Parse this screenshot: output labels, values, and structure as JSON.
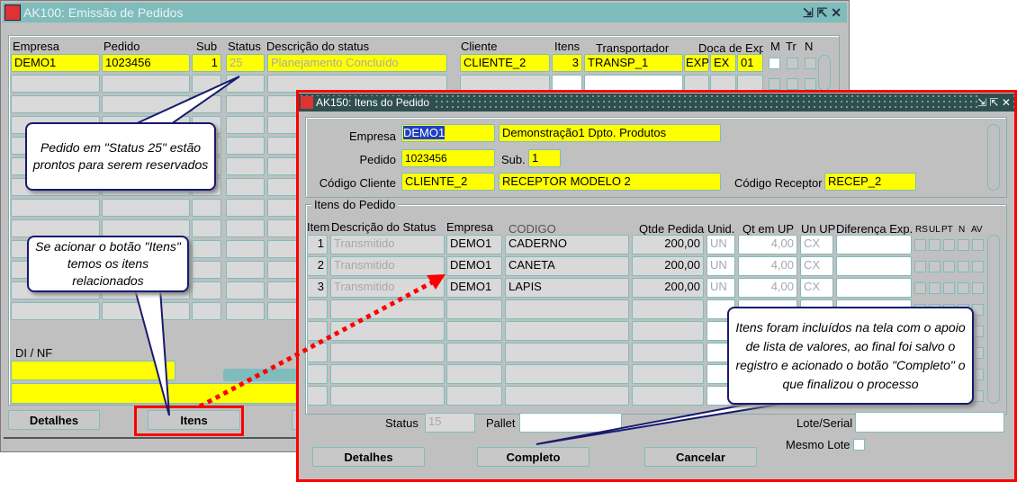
{
  "main_window": {
    "title": "AK100: Emissão de Pedidos",
    "headers": {
      "empresa": "Empresa",
      "pedido": "Pedido",
      "sub": "Sub",
      "status": "Status",
      "descricao": "Descrição do status",
      "cliente": "Cliente",
      "itens": "Itens",
      "transportador": "Transportador",
      "doca": "Doca de Exp",
      "m": "M",
      "tr": "Tr",
      "n": "N"
    },
    "row": {
      "empresa": "DEMO1",
      "pedido": "1023456",
      "sub": "1",
      "status": "25",
      "descricao": "Planejamento Concluído",
      "cliente": "CLIENTE_2",
      "itens": "3",
      "transportador": "TRANSP_1",
      "doca1": "EXP",
      "doca2": "EX",
      "doca3": "01"
    },
    "di_nf_label": "DI / NF",
    "buttons": {
      "detalhes": "Detalhes",
      "itens": "Itens"
    }
  },
  "items_window": {
    "title": "AK150: Itens do Pedido",
    "empresa_label": "Empresa",
    "empresa": "DEMO1",
    "empresa_desc": "Demonstração1 Dpto. Produtos",
    "pedido_label": "Pedido",
    "pedido": "1023456",
    "sub_label": "Sub.",
    "sub": "1",
    "cliente_label": "Código Cliente",
    "cliente": "CLIENTE_2",
    "cliente_desc": "RECEPTOR MODELO 2",
    "receptor_label": "Código Receptor",
    "receptor": "RECEP_2",
    "group_label": "Itens do Pedido",
    "headers": {
      "item": "Item",
      "descricao": "Descrição do Status",
      "empresa": "Empresa",
      "codigo": "CODIGO",
      "qtde": "Qtde Pedida",
      "unid": "Unid.",
      "qtup": "Qt em UP",
      "unup": "Un UP",
      "dif": "Diferença Exp.",
      "rs": "RS",
      "ul": "UL",
      "pt": "PT",
      "n": "N",
      "av": "AV"
    },
    "rows": [
      {
        "item": "1",
        "descricao": "Transmitido",
        "empresa": "DEMO1",
        "codigo": "CADERNO",
        "qtde": "200,00",
        "unid": "UN",
        "qtup": "4,00",
        "unup": "CX"
      },
      {
        "item": "2",
        "descricao": "Transmitido",
        "empresa": "DEMO1",
        "codigo": "CANETA",
        "qtde": "200,00",
        "unid": "UN",
        "qtup": "4,00",
        "unup": "CX"
      },
      {
        "item": "3",
        "descricao": "Transmitido",
        "empresa": "DEMO1",
        "codigo": "LAPIS",
        "qtde": "200,00",
        "unid": "UN",
        "qtup": "4,00",
        "unup": "CX"
      }
    ],
    "status_label": "Status",
    "status": "15",
    "pallet_label": "Pallet",
    "lote_label": "Lote/Serial",
    "mesmo_lote_label": "Mesmo Lote",
    "buttons": {
      "detalhes": "Detalhes",
      "completo": "Completo",
      "cancelar": "Cancelar"
    }
  },
  "callouts": {
    "status": "Pedido em \"Status 25\" estão prontos para serem reservados",
    "itens": "Se acionar o botão \"Itens\" temos os itens relacionados",
    "completo": "Itens foram incluídos na tela com o apoio de lista de valores, ao final foi salvo o registro e acionado o botão \"Completo\" o que finalizou o processo"
  },
  "colors": {
    "field_highlight": "#ffff00",
    "title_bar": "#7fbcbc",
    "annotation_red": "#ff0000",
    "callout_border": "#1a1a6e"
  }
}
